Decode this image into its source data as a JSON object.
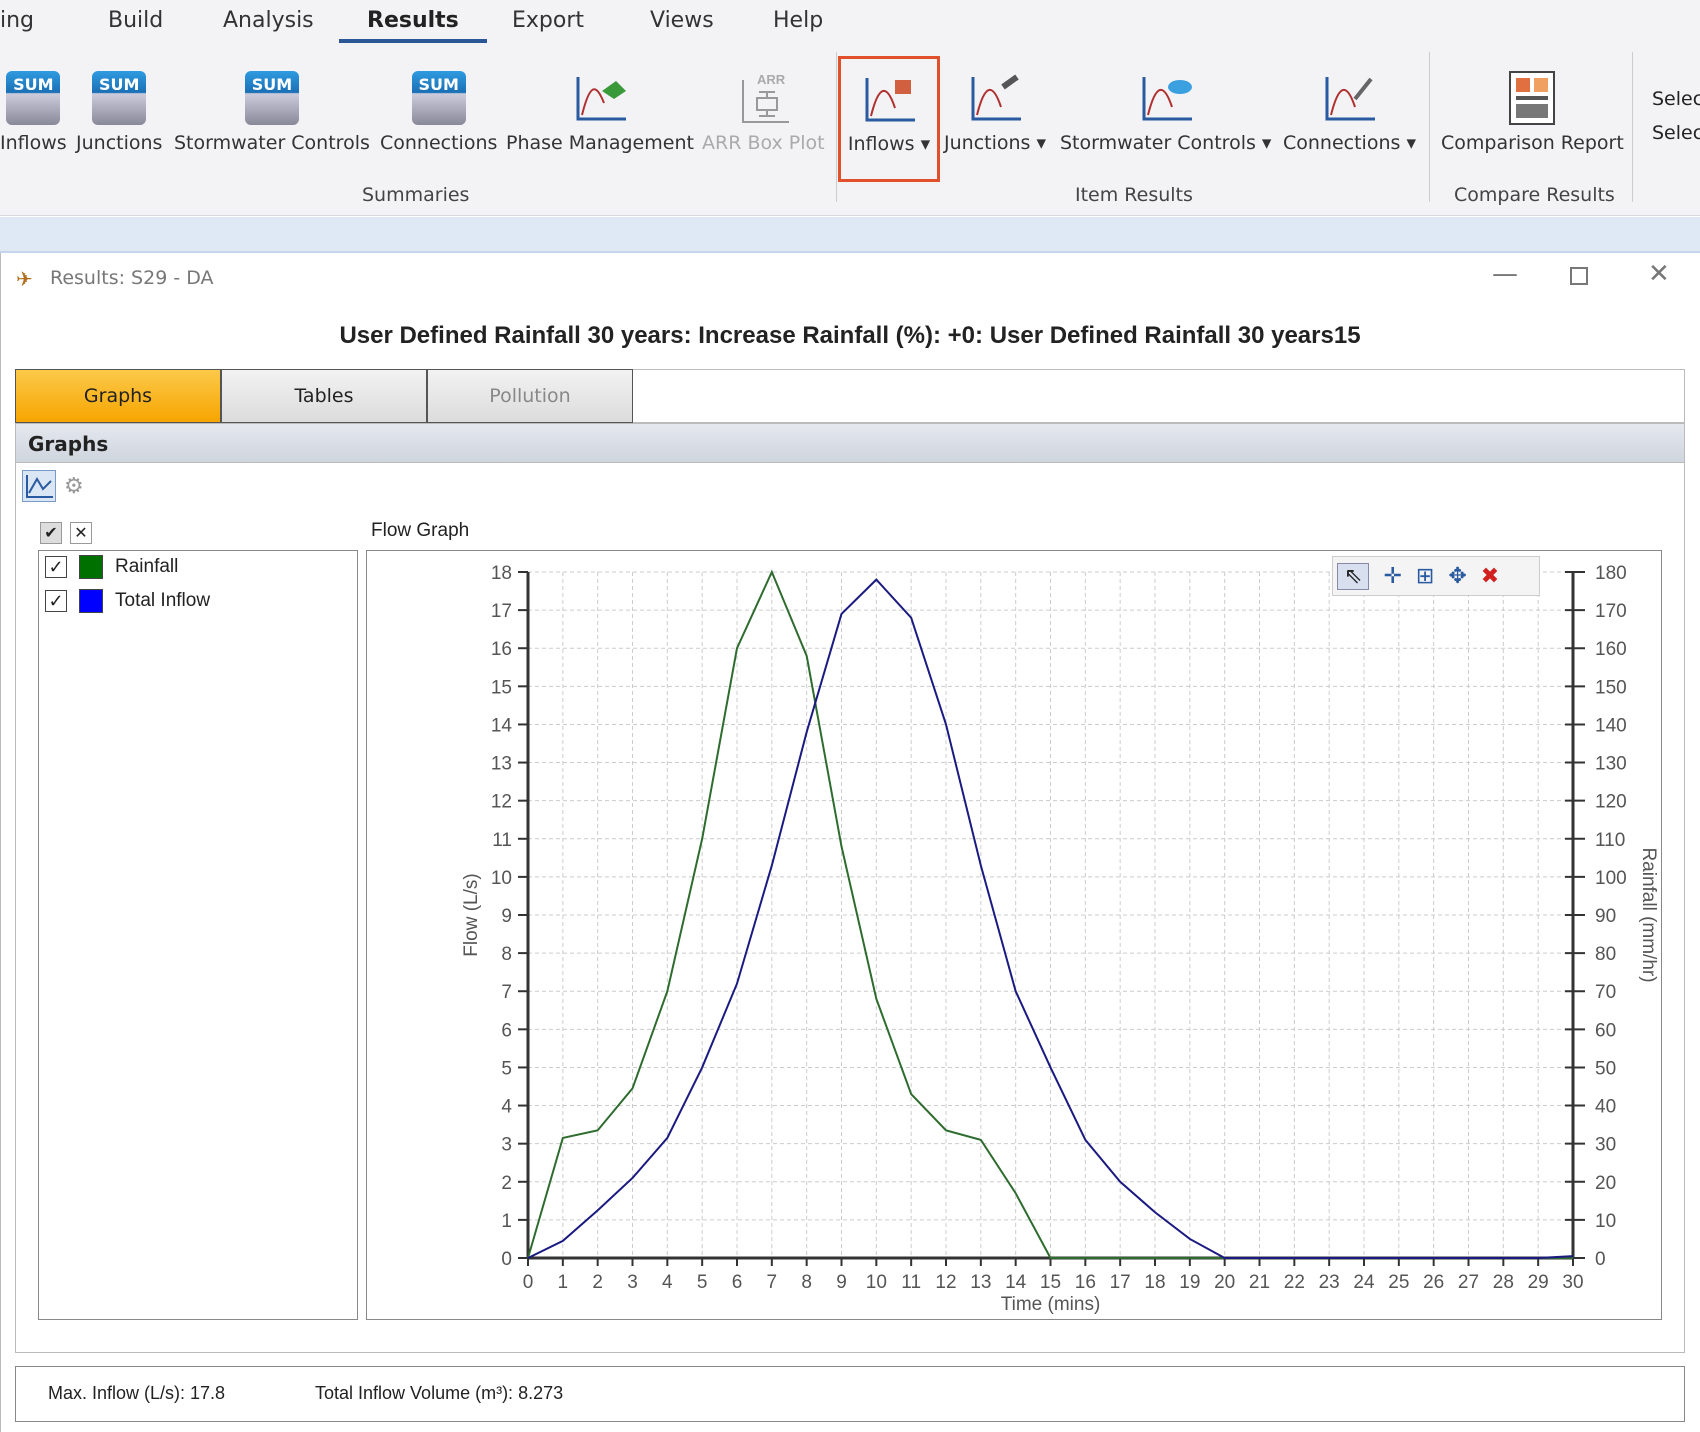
{
  "menu": {
    "items": [
      "ing",
      "Build",
      "Analysis",
      "Results",
      "Export",
      "Views",
      "Help"
    ],
    "active": "Results"
  },
  "ribbon": {
    "summaries": {
      "label": "Summaries",
      "buttons": [
        "Inflows",
        "Junctions",
        "Stormwater Controls",
        "Connections",
        "Phase Management",
        "ARR Box Plot"
      ],
      "sum_badge": "SUM",
      "arr_badge": "ARR"
    },
    "item_results": {
      "label": "Item Results",
      "buttons": [
        "Inflows",
        "Junctions",
        "Stormwater Controls",
        "Connections"
      ],
      "highlighted": "Inflows",
      "highlight_color": "#e0502a"
    },
    "compare_results": {
      "label": "Compare Results",
      "buttons": [
        "Comparison Report"
      ]
    },
    "select": [
      "Selec",
      "Selec"
    ]
  },
  "window": {
    "title": "Results: S29 - DA",
    "heading": "User Defined Rainfall 30 years: Increase Rainfall (%): +0: User Defined Rainfall 30 years15"
  },
  "tabs": [
    {
      "label": "Graphs",
      "active": true
    },
    {
      "label": "Tables"
    },
    {
      "label": "Pollution",
      "disabled": true
    }
  ],
  "section_title": "Graphs",
  "legend": {
    "items": [
      {
        "label": "Rainfall",
        "color": "#007000",
        "checked": true
      },
      {
        "label": "Total Inflow",
        "color": "#0000ff",
        "checked": true
      }
    ]
  },
  "graph_title": "Flow Graph",
  "chart_data": {
    "type": "line",
    "xlabel": "Time (mins)",
    "ylabel": "Flow (L/s)",
    "y2label": "Rainfall (mm/hr)",
    "xlim": [
      0,
      30
    ],
    "ylim": [
      0,
      18
    ],
    "y2lim": [
      0,
      180
    ],
    "grid": true,
    "x": [
      0,
      1,
      2,
      3,
      4,
      5,
      6,
      7,
      8,
      9,
      10,
      11,
      12,
      13,
      14,
      15,
      16,
      17,
      18,
      19,
      20,
      21,
      22,
      23,
      24,
      25,
      26,
      27,
      28,
      29,
      30
    ],
    "series": [
      {
        "name": "Rainfall",
        "axis": "right",
        "color": "#2e6b2e",
        "values": [
          0,
          31.5,
          33.5,
          44.5,
          70,
          110,
          160,
          180,
          158,
          108,
          68,
          43,
          33.5,
          31,
          17,
          0,
          0,
          0,
          0,
          0,
          0,
          0,
          0,
          0,
          0,
          0,
          0,
          0,
          0,
          0,
          0
        ]
      },
      {
        "name": "Total Inflow",
        "axis": "left",
        "color": "#1a1a80",
        "values": [
          0,
          0.45,
          1.25,
          2.1,
          3.15,
          5,
          7.2,
          10.3,
          13.8,
          16.9,
          17.8,
          16.8,
          14,
          10.3,
          7,
          5,
          3.1,
          2,
          1.2,
          0.5,
          0,
          0,
          0,
          0,
          0,
          0,
          0,
          0,
          0,
          0,
          0.05
        ]
      }
    ]
  },
  "footer": {
    "max_inflow": "Max. Inflow (L/s): 17.8",
    "total_volume": "Total Inflow Volume (m³): 8.273"
  }
}
